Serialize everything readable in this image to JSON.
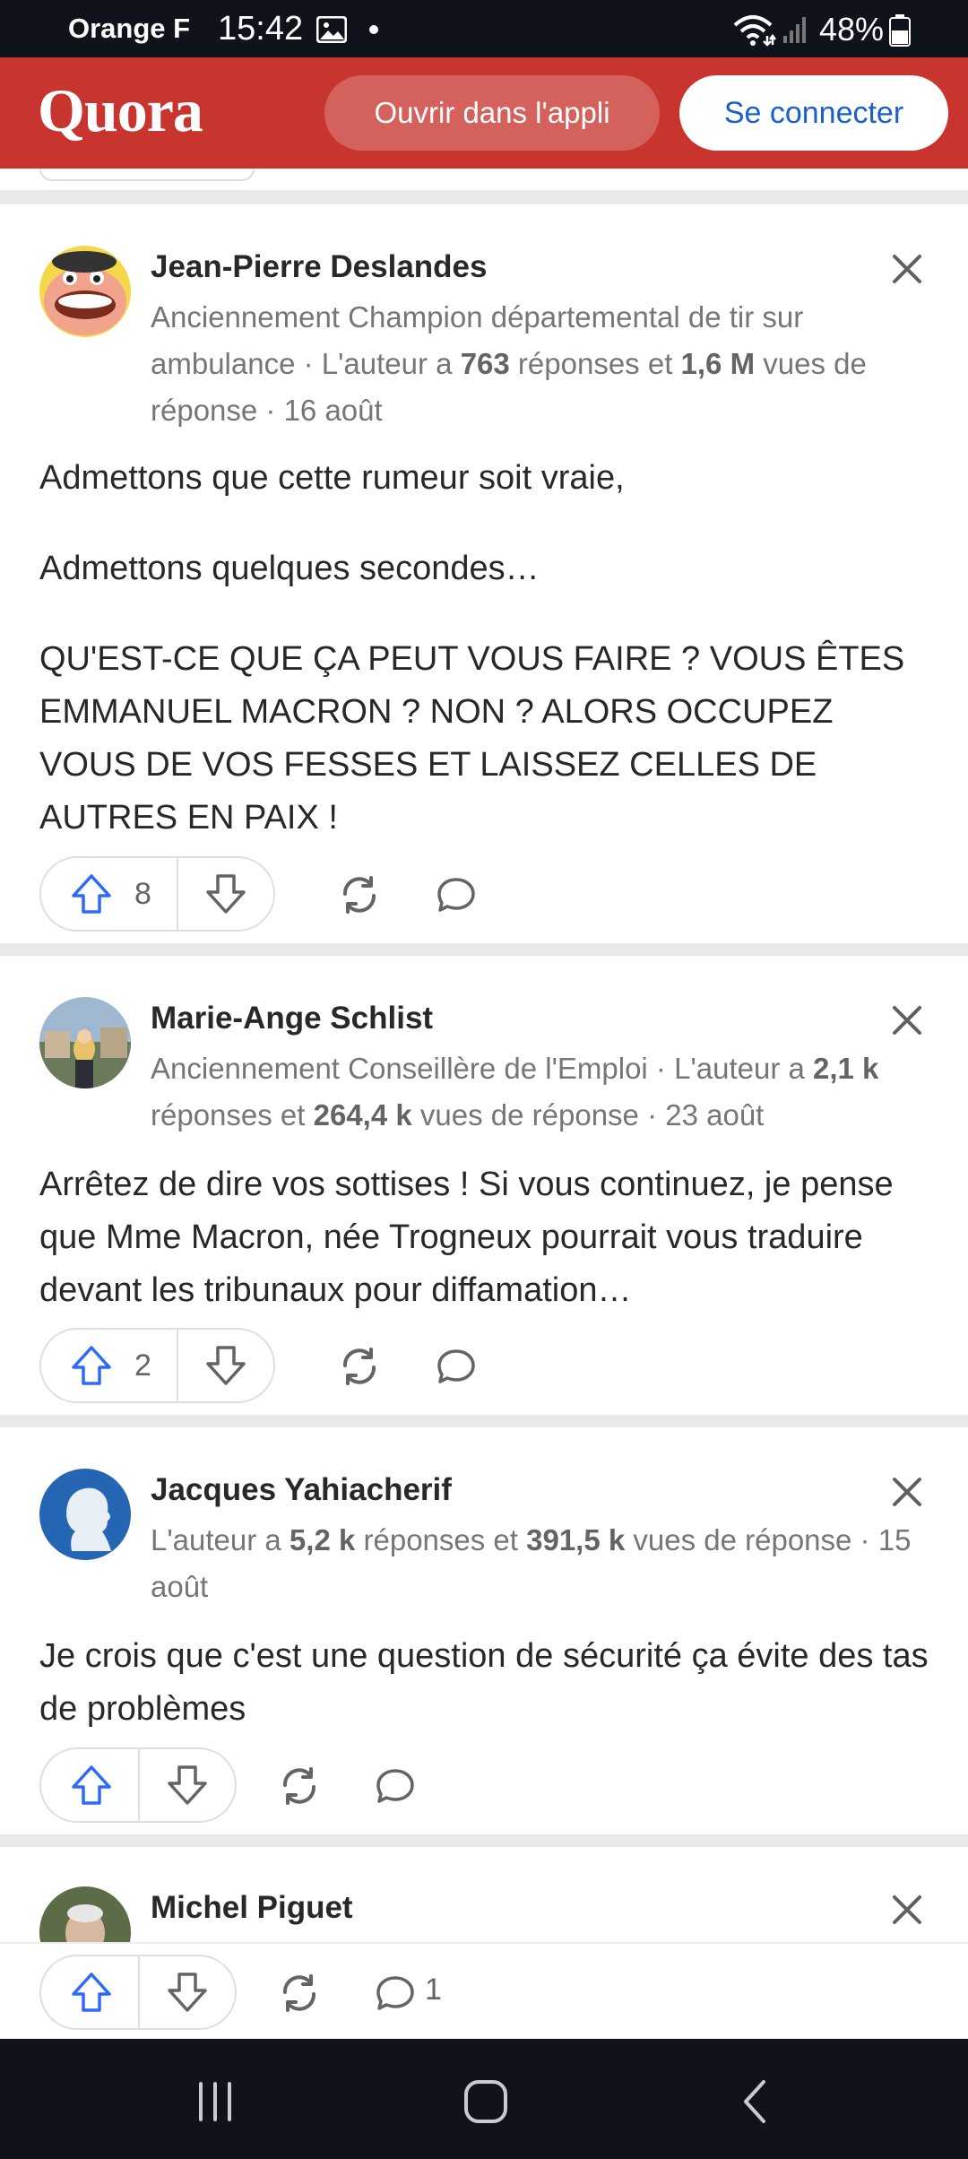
{
  "status_bar": {
    "carrier": "Orange F",
    "time": "15:42",
    "battery": "48%"
  },
  "header": {
    "logo": "Quora",
    "open_app_label": "Ouvrir dans l'appli",
    "login_label": "Se connecter"
  },
  "answers": [
    {
      "author": "Jean-Pierre Deslandes",
      "cred_prefix": "Anciennement Champion départemental de tir sur ambulance · L'auteur a ",
      "answers_count": "763",
      "answers_mid": " réponses et ",
      "views_count": "1,6 M",
      "cred_suffix": " vues de réponse · 16 août",
      "paragraphs": [
        "Admettons que cette rumeur soit vraie,",
        "Admettons quelques secondes…",
        "QU'EST-CE QUE ÇA PEUT VOUS FAIRE ? VOUS ÊTES EMMANUEL MACRON ? NON ? ALORS OCCUPEZ VOUS DE VOS FESSES ET LAISSEZ CELLES DE AUTRES EN PAIX !"
      ],
      "upvotes": "8"
    },
    {
      "author": "Marie-Ange Schlist",
      "cred_prefix": "Anciennement Conseillère de l'Emploi · L'auteur a ",
      "answers_count": "2,1 k",
      "answers_mid": " réponses et ",
      "views_count": "264,4 k",
      "cred_suffix": " vues de réponse · 23 août",
      "paragraphs": [
        "Arrêtez de dire vos sottises ! Si vous continuez, je pense que Mme Macron, née Trogneux pourrait vous traduire devant les tribunaux pour diffamation…"
      ],
      "upvotes": "2"
    },
    {
      "author": "Jacques Yahiacherif",
      "cred_prefix": "L'auteur a ",
      "answers_count": "5,2 k",
      "answers_mid": " réponses et ",
      "views_count": "391,5 k",
      "cred_suffix": " vues de réponse · 15 août",
      "paragraphs": [
        "Je crois que c'est une question de sécurité ça évite des tas de problèmes"
      ]
    },
    {
      "author": "Michel Piguet",
      "comments": "1"
    }
  ],
  "colors": {
    "brand": "#c8352f",
    "link_blue": "#195fcd",
    "upvote_blue": "#2e69ff"
  }
}
